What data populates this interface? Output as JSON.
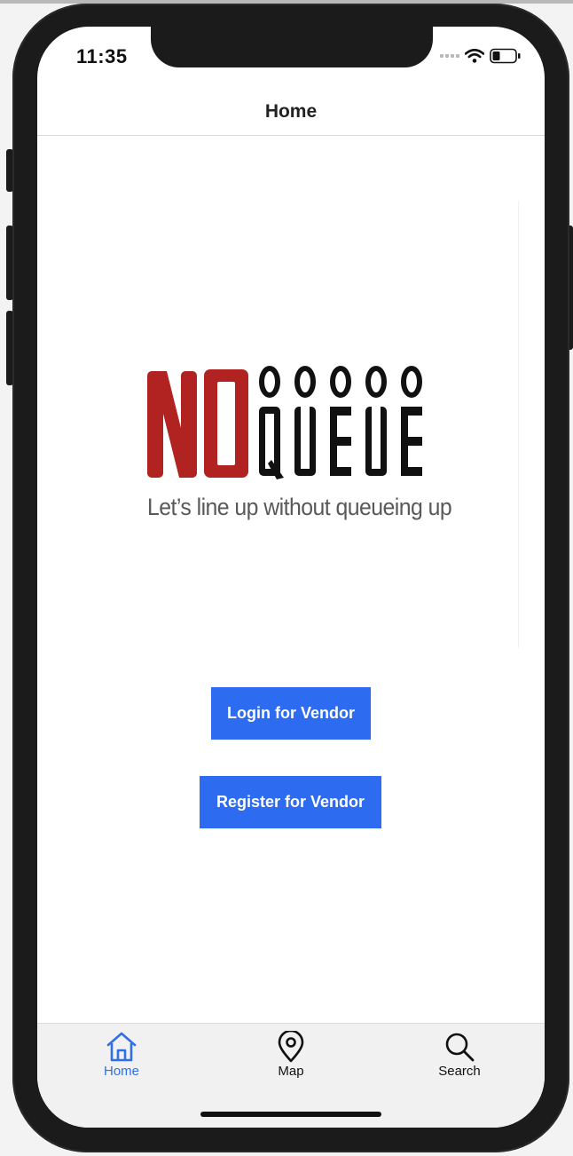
{
  "status_bar": {
    "time": "11:35"
  },
  "nav": {
    "title": "Home"
  },
  "logo": {
    "brand_no": "NO",
    "brand_queue": "QUEUE",
    "tagline": "Let’s line up without queueing up"
  },
  "buttons": {
    "login_label": "Login for Vendor",
    "register_label": "Register for Vendor"
  },
  "tabs": [
    {
      "label": "Home",
      "icon": "home-icon",
      "active": true
    },
    {
      "label": "Map",
      "icon": "map-pin-icon",
      "active": false
    },
    {
      "label": "Search",
      "icon": "search-icon",
      "active": false
    }
  ],
  "colors": {
    "accent": "#2d6bf0",
    "brand_red": "#b02320",
    "tab_active": "#2f6fe8"
  }
}
